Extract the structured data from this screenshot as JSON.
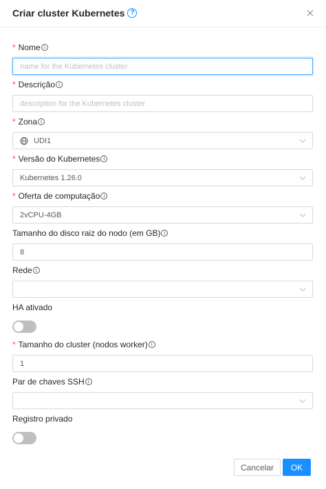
{
  "modal": {
    "title": "Criar cluster Kubernetes",
    "help_glyph": "?"
  },
  "fields": {
    "name": {
      "label": "Nome",
      "required": "*",
      "placeholder": "name for the Kubernetes cluster"
    },
    "description": {
      "label": "Descrição",
      "required": "*",
      "placeholder": "description for the Kubernetes cluster"
    },
    "zone": {
      "label": "Zona",
      "required": "*",
      "value": "UDI1"
    },
    "k8s_version": {
      "label": "Versão do Kubernetes",
      "required": "*",
      "value": "Kubernetes 1.26.0"
    },
    "compute_offering": {
      "label": "Oferta de computação",
      "required": "*",
      "value": "2vCPU-4GB"
    },
    "root_disk": {
      "label": "Tamanho do disco raiz do nodo (em GB)",
      "value": "8"
    },
    "network": {
      "label": "Rede",
      "value": ""
    },
    "ha": {
      "label": "HA ativado",
      "enabled": false
    },
    "cluster_size": {
      "label": "Tamanho do cluster (nodos worker)",
      "required": "*",
      "value": "1"
    },
    "ssh_keypair": {
      "label": "Par de chaves SSH",
      "value": ""
    },
    "private_registry": {
      "label": "Registro privado",
      "enabled": false
    }
  },
  "buttons": {
    "cancel": "Cancelar",
    "ok": "OK"
  },
  "icons": {
    "info": "info-circle-icon",
    "close": "close-icon",
    "chevron": "chevron-down-icon",
    "zone": "globe-icon"
  },
  "colors": {
    "primary": "#1890ff",
    "required": "#ff4d4f",
    "border": "#d9d9d9",
    "placeholder": "#bfbfbf",
    "toggle_off": "#bfbfbf"
  }
}
